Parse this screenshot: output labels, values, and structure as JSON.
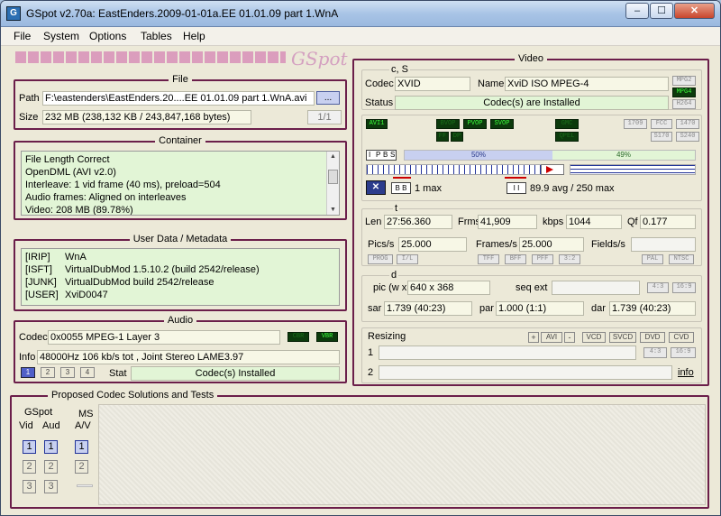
{
  "window": {
    "title": "GSpot v2.70a: EastEnders.2009-01-01a.EE 01.01.09 part 1.WnA",
    "icon": "gspot-app-icon",
    "min": "–",
    "max": "☐",
    "close": "✕"
  },
  "menu": [
    "File",
    "System",
    "Options",
    "Tables",
    "Help"
  ],
  "logo": "GSpot",
  "file": {
    "title": "File",
    "path_label": "Path",
    "path": "F:\\eastenders\\EastEnders.20....EE 01.01.09 part 1.WnA.avi",
    "browse": "...",
    "size_label": "Size",
    "size": "232 MB (238,132 KB / 243,847,168 bytes)",
    "index": "1/1"
  },
  "container": {
    "title": "Container",
    "lines": [
      "File Length Correct",
      "OpenDML (AVI v2.0)",
      "Interleave: 1 vid frame (40 ms), preload=504",
      "Audio frames: Aligned on interleaves",
      "Video: 208 MB (89.78%)"
    ]
  },
  "metadata": {
    "title": "User Data / Metadata",
    "rows": [
      {
        "key": "[IRIP]",
        "val": "WnA"
      },
      {
        "key": "[ISFT]",
        "val": "VirtualDubMod 1.5.10.2 (build 2542/release)"
      },
      {
        "key": "[JUNK]",
        "val": "VirtualDubMod build 2542/release"
      },
      {
        "key": "[USER]",
        "val": "XviD0047"
      }
    ]
  },
  "audio": {
    "title": "Audio",
    "codec_label": "Codec",
    "codec": "0x0055 MPEG-1 Layer 3",
    "cbr": "CBR",
    "vbr": "VBR",
    "info_label": "Info",
    "info": "48000Hz  106 kb/s tot , Joint Stereo LAME3.97",
    "streams": [
      "1",
      "2",
      "3",
      "4"
    ],
    "stat_label": "Stat",
    "stat": "Codec(s) Installed"
  },
  "proposed": {
    "title": "Proposed Codec Solutions and Tests",
    "gspot": "GSpot",
    "vid": "Vid",
    "aud": "Aud",
    "ms": "MS",
    "av": "A/V",
    "nums": [
      "1",
      "2",
      "3"
    ]
  },
  "video": {
    "title": "Video",
    "cs_title": "c, S",
    "codec_label": "Codec",
    "codec": "XVID",
    "name_label": "Name",
    "name": "XviD ISO MPEG-4",
    "badges": [
      "MPG2",
      "MPG4",
      "H264"
    ],
    "status_label": "Status",
    "status": "Codec(s) are Installed",
    "flags_left": [
      "AVI1"
    ],
    "flags_mid": [
      "BVOP",
      "PVOP",
      "SVOP",
      "FF",
      "DP"
    ],
    "flags_right": [
      "GMC",
      "QPEL"
    ],
    "flags_std": [
      "1709",
      "FCC",
      "1470",
      "S170",
      "S240"
    ],
    "ipb": [
      "I",
      "P",
      "B",
      "S"
    ],
    "pct_b": "50%",
    "pct_p": "49%",
    "max_label": "1 max",
    "avg_label": "89.9 avg / 250 max",
    "t_title": "t",
    "len_label": "Len",
    "len": "27:56.360",
    "frms_label": "Frms",
    "frms": "41,909",
    "kbps_label": "kbps",
    "kbps": "1044",
    "qf_label": "Qf",
    "qf": "0.177",
    "pics_label": "Pics/s",
    "pics": "25.000",
    "frames_label": "Frames/s",
    "frames": "25.000",
    "fields_label": "Fields/s",
    "fields": "",
    "t_buttons": [
      "PROG",
      "I/L",
      "TFF",
      "BFF",
      "PFF",
      "3:2",
      "PAL",
      "NTSC"
    ],
    "d_title": "d",
    "pic_label": "pic (w x",
    "pic": "640 x 368",
    "seq_label": "seq ext",
    "seq": "",
    "ar_buttons": [
      "4:3",
      "16:9"
    ],
    "sar_label": "sar",
    "sar": "1.739 (40:23)",
    "par_label": "par",
    "par": "1.000 (1:1)",
    "dar_label": "dar",
    "dar": "1.739 (40:23)",
    "resizing_label": "Resizing",
    "resize_buttons": [
      "+",
      "AVI",
      "-",
      "VCD",
      "SVCD",
      "DVD",
      "CVD"
    ],
    "r1": "1",
    "r2": "2",
    "info_link": "info"
  }
}
